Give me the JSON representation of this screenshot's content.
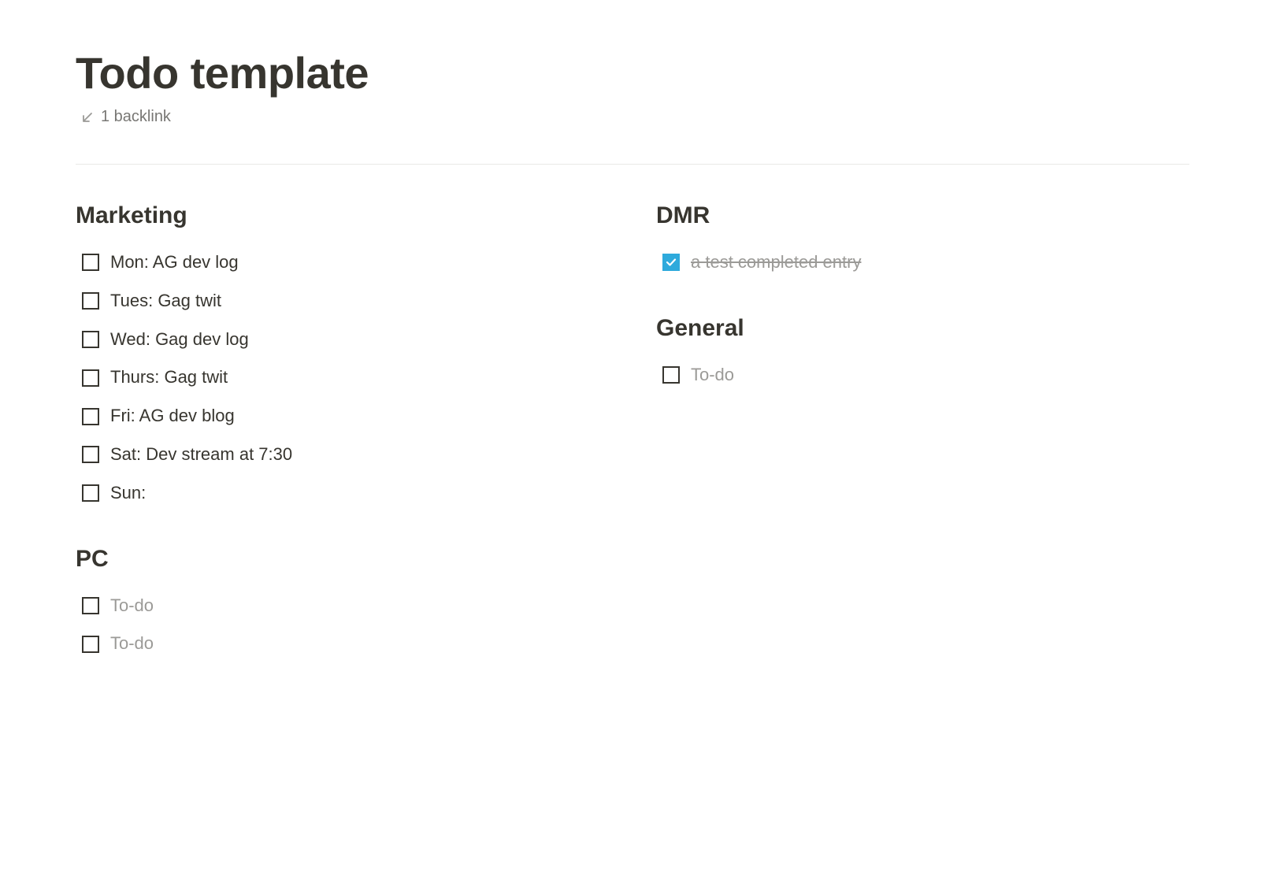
{
  "page": {
    "title": "Todo template",
    "backlink_text": "1 backlink"
  },
  "columns": {
    "left": {
      "sections": [
        {
          "heading": "Marketing",
          "items": [
            {
              "label": "Mon: AG dev log",
              "checked": false,
              "placeholder": false
            },
            {
              "label": "Tues: Gag twit",
              "checked": false,
              "placeholder": false
            },
            {
              "label": "Wed: Gag dev log",
              "checked": false,
              "placeholder": false
            },
            {
              "label": "Thurs: Gag twit",
              "checked": false,
              "placeholder": false
            },
            {
              "label": "Fri: AG dev blog",
              "checked": false,
              "placeholder": false
            },
            {
              "label": "Sat: Dev stream at 7:30",
              "checked": false,
              "placeholder": false
            },
            {
              "label": "Sun:",
              "checked": false,
              "placeholder": false
            }
          ]
        },
        {
          "heading": "PC",
          "items": [
            {
              "label": "To-do",
              "checked": false,
              "placeholder": true
            },
            {
              "label": "To-do",
              "checked": false,
              "placeholder": true
            }
          ]
        }
      ]
    },
    "right": {
      "sections": [
        {
          "heading": "DMR",
          "items": [
            {
              "label": "a test completed entry",
              "checked": true,
              "placeholder": false
            }
          ]
        },
        {
          "heading": "General",
          "items": [
            {
              "label": "To-do",
              "checked": false,
              "placeholder": true
            }
          ]
        }
      ]
    }
  }
}
